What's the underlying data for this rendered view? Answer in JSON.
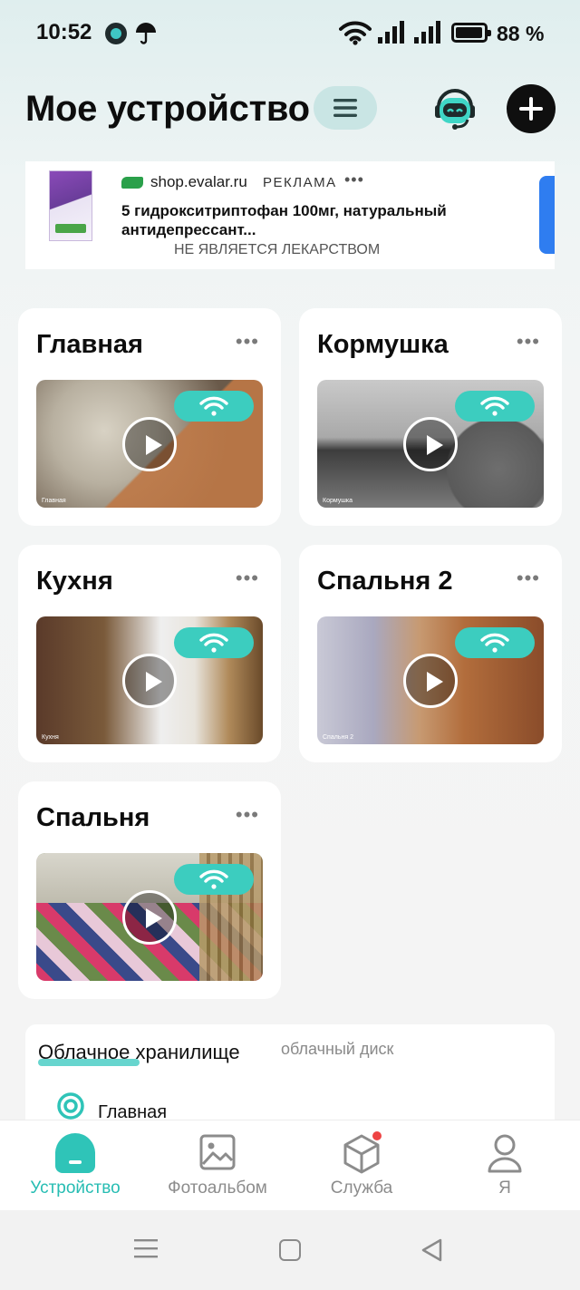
{
  "status_bar": {
    "time": "10:52",
    "battery": "88 %"
  },
  "header": {
    "title": "Мое устройство"
  },
  "ad": {
    "domain": "shop.evalar.ru",
    "label": "РЕКЛАМА",
    "dots": "•••",
    "text": "5 гидрокситриптофан 100мг, натуральный антидепрессант...",
    "disclaimer": "НЕ ЯВЛЯЕТСЯ ЛЕКАРСТВОМ"
  },
  "devices": [
    {
      "name": "Главная",
      "cam_label": "Главная",
      "online": true
    },
    {
      "name": "Кормушка",
      "cam_label": "Кормушка",
      "online": true
    },
    {
      "name": "Кухня",
      "cam_label": "Кухня",
      "online": true
    },
    {
      "name": "Спальня 2",
      "cam_label": "Спальня 2",
      "online": true
    },
    {
      "name": "Спальня",
      "cam_label": "",
      "online": true
    }
  ],
  "card_more": "•••",
  "cloud": {
    "title": "Облачное хранилище",
    "subtitle": "облачный диск",
    "items": [
      {
        "label": "Главная"
      }
    ]
  },
  "tabs": [
    {
      "label": "Устройство",
      "icon": "home-icon",
      "active": true
    },
    {
      "label": "Фотоальбом",
      "icon": "photo-icon",
      "active": false
    },
    {
      "label": "Служба",
      "icon": "box-icon",
      "active": false,
      "badge": true
    },
    {
      "label": "Я",
      "icon": "person-icon",
      "active": false
    }
  ],
  "colors": {
    "accent": "#2fc4b8",
    "wifi_pill": "#3ccdbf",
    "badge": "#ee4444"
  }
}
